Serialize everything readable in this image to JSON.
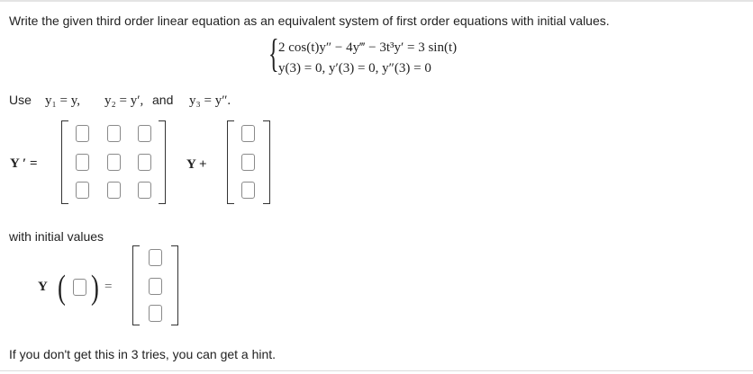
{
  "instruction": "Write the given third order linear equation as an equivalent system of first order equations with initial values.",
  "system": {
    "equation": "2 cos(t)y″ − 4y‴ − 3t³y′ = 3 sin(t)",
    "initial_conditions": "y(3) = 0,   y′(3) = 0,   y″(3) = 0"
  },
  "use_line": {
    "use": "Use",
    "def1": "y₁ = y,",
    "def2": "y₂ = y′, ",
    "and": "and",
    "def3": "y₃ = y″."
  },
  "matrix_eq": {
    "lhs": "Y ′ =",
    "mid": "Y +"
  },
  "initial_values_label": "with initial values",
  "iv_eq": {
    "y": "Y",
    "eq": "="
  },
  "hint": "If you don't get this in 3 tries, you can get a hint."
}
